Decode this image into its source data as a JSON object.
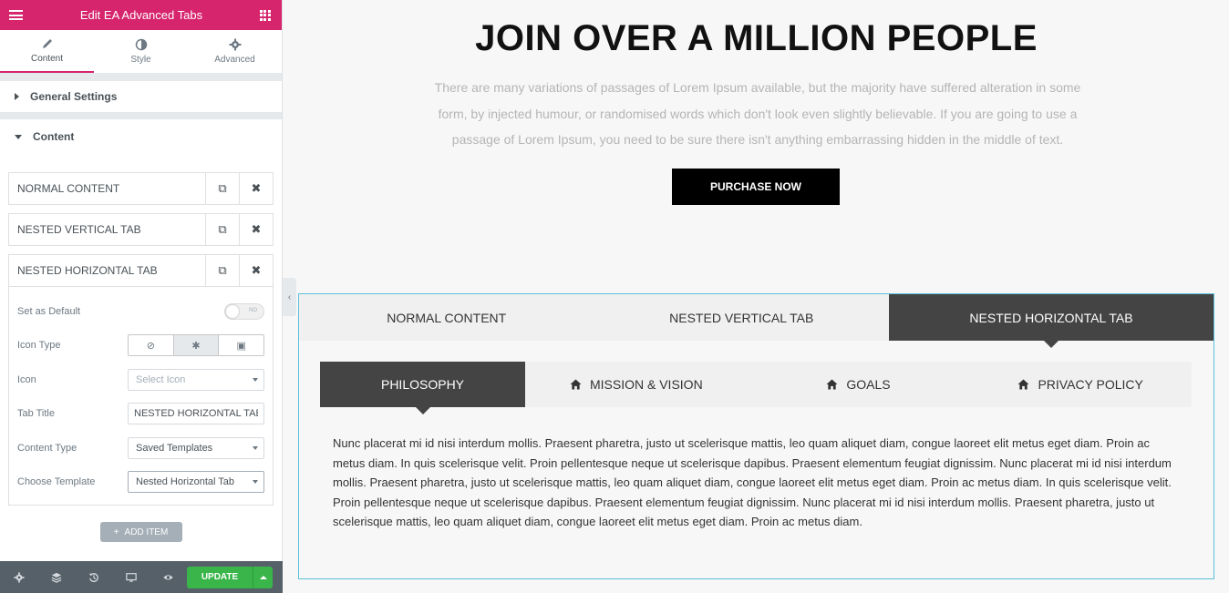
{
  "panel": {
    "title": "Edit EA Advanced Tabs",
    "tabs": [
      {
        "label": "Content",
        "icon": "pencil-icon",
        "active": true
      },
      {
        "label": "Style",
        "icon": "half-circle-icon",
        "active": false
      },
      {
        "label": "Advanced",
        "icon": "gear-icon",
        "active": false
      }
    ],
    "sections": {
      "general": "General Settings",
      "content": "Content"
    },
    "repeater_items": [
      {
        "label": "NORMAL CONTENT"
      },
      {
        "label": "NESTED VERTICAL TAB"
      },
      {
        "label": "NESTED HORIZONTAL TAB"
      }
    ],
    "controls": {
      "set_default_label": "Set as Default",
      "set_default_toggle": "NO",
      "icon_type_label": "Icon Type",
      "icon_label": "Icon",
      "icon_placeholder": "Select Icon",
      "tab_title_label": "Tab Title",
      "tab_title_value": "NESTED HORIZONTAL TAB",
      "content_type_label": "Content Type",
      "content_type_value": "Saved Templates",
      "template_label": "Choose Template",
      "template_value": "Nested Horizontal Tab"
    },
    "add_item": "ADD ITEM",
    "update": "UPDATE"
  },
  "hero": {
    "title": "JOIN OVER A MILLION PEOPLE",
    "description": "There are many variations of passages of Lorem Ipsum available, but the majority have suffered alteration in some form, by injected humour, or randomised words which don't look even slightly believable. If you are going to use a passage of Lorem Ipsum, you need to be sure there isn't anything embarrassing hidden in the middle of text.",
    "cta": "PURCHASE NOW"
  },
  "tabs": {
    "outer": [
      "NORMAL CONTENT",
      "NESTED VERTICAL TAB",
      "NESTED HORIZONTAL TAB"
    ],
    "inner": [
      "PHILOSOPHY",
      "MISSION & VISION",
      "GOALS",
      "PRIVACY POLICY"
    ],
    "body": "Nunc placerat mi id nisi interdum mollis. Praesent pharetra, justo ut scelerisque mattis, leo quam aliquet diam, congue laoreet elit metus eget diam. Proin ac metus diam. In quis scelerisque velit. Proin pellentesque neque ut scelerisque dapibus. Praesent elementum feugiat dignissim. Nunc placerat mi id nisi interdum mollis. Praesent pharetra, justo ut scelerisque mattis, leo quam aliquet diam, congue laoreet elit metus eget diam. Proin ac metus diam. In quis scelerisque velit. Proin pellentesque neque ut scelerisque dapibus. Praesent elementum feugiat dignissim. Nunc placerat mi id nisi interdum mollis. Praesent pharetra, justo ut scelerisque mattis, leo quam aliquet diam, congue laoreet elit metus eget diam. Proin ac metus diam."
  },
  "colors": {
    "brand": "#d6246d",
    "update": "#39b54a",
    "dark_tab": "#444444",
    "border_accent": "#5bc0de"
  }
}
